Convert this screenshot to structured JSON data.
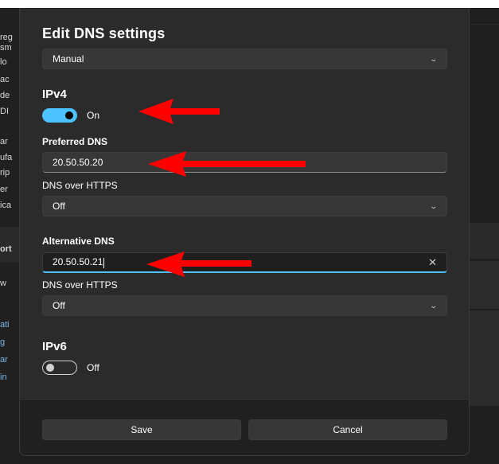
{
  "dialog": {
    "title": "Edit DNS settings",
    "mode_select": "Manual",
    "ipv4": {
      "heading": "IPv4",
      "toggle_label": "On",
      "preferred_label": "Preferred DNS",
      "preferred_value": "20.50.50.20",
      "preferred_https_label": "DNS over HTTPS",
      "preferred_https_value": "Off",
      "alternative_label": "Alternative DNS",
      "alternative_value": "20.50.50.21",
      "alternative_https_label": "DNS over HTTPS",
      "alternative_https_value": "Off"
    },
    "ipv6": {
      "heading": "IPv6",
      "toggle_label": "Off"
    },
    "buttons": {
      "save": "Save",
      "cancel": "Cancel"
    }
  },
  "background_fragments": [
    "reg",
    "sm",
    "lo",
    "ac",
    "de",
    "DI",
    "ar",
    "ufa",
    "rip",
    "er",
    "ica",
    "ort",
    "w",
    "ati",
    "g",
    "ar",
    "in"
  ],
  "colors": {
    "accent": "#4cc2ff",
    "annotation_arrow": "#ff0000",
    "dialog_bg": "#2b2b2b"
  },
  "icons": {
    "chevron": "chevron-down-icon",
    "clear": "clear-x-icon",
    "arrow": "red-arrow-annotation"
  }
}
